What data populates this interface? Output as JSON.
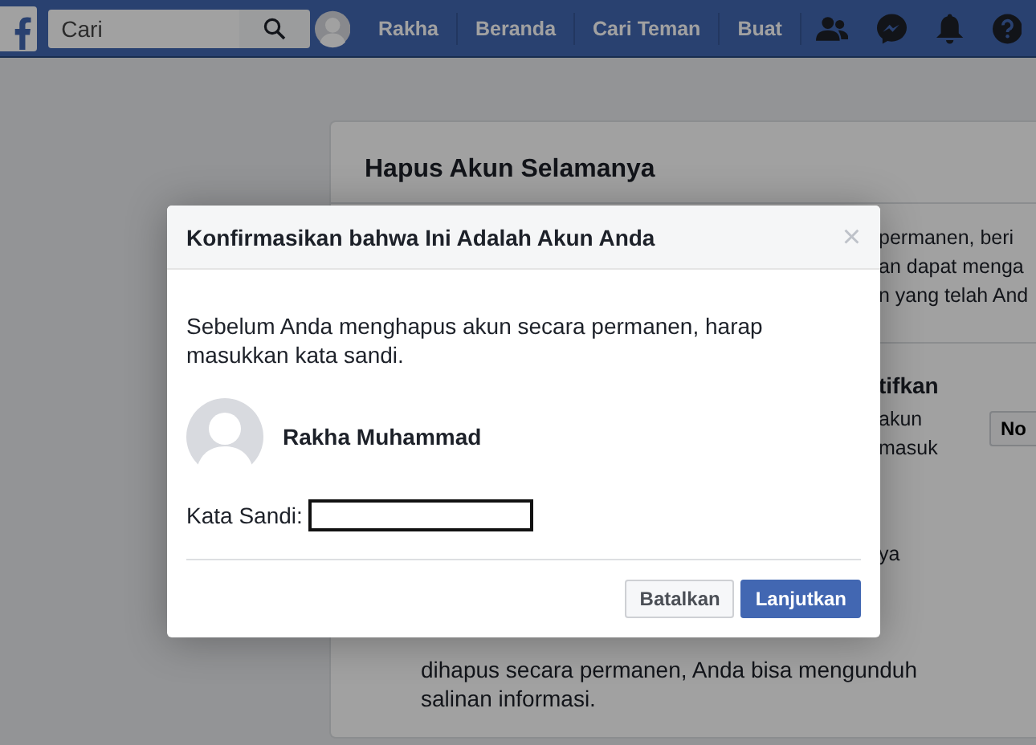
{
  "navbar": {
    "search": {
      "placeholder": "Cari"
    },
    "profile": "Rakha",
    "links": [
      "Beranda",
      "Cari Teman",
      "Buat"
    ]
  },
  "background_card": {
    "title": "Hapus Akun Selamanya",
    "intro_fragments": [
      "permanen, beri",
      "an dapat menga",
      "n yang telah And"
    ],
    "section_heading_fragment": "tifkan",
    "section_fragments": [
      "akun",
      "masuk"
    ],
    "button_fragment": "No",
    "lower_fragment": "ya",
    "paragraph_lines": [
      "dihapus secara permanen, Anda bisa mengunduh",
      "salinan informasi."
    ]
  },
  "dialog": {
    "title": "Konfirmasikan bahwa Ini Adalah Akun Anda",
    "close": "×",
    "message": "Sebelum Anda menghapus akun secara permanen, harap masukkan kata sandi.",
    "user_name": "Rakha Muhammad",
    "password_label": "Kata Sandi:",
    "buttons": [
      {
        "label": "Batalkan",
        "kind": "secondary"
      },
      {
        "label": "Lanjutkan",
        "kind": "primary"
      }
    ]
  }
}
